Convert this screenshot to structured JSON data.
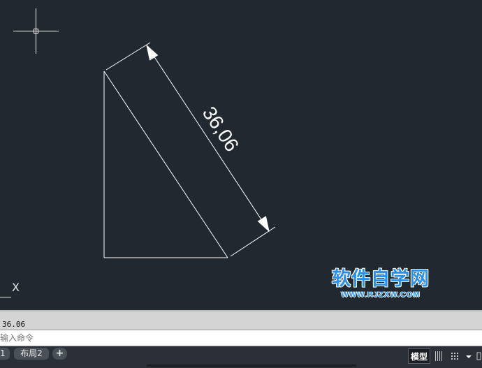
{
  "drawing": {
    "dimension_value": "36,06",
    "ucs_axis_label": "X"
  },
  "watermark": {
    "title": "软件自学网",
    "url": "WWW.RJZXW.COM"
  },
  "command_history": {
    "line": "36.06"
  },
  "command_line": {
    "placeholder": "输入命令"
  },
  "layout_tabs": [
    {
      "label": "1"
    },
    {
      "label": "布局2"
    },
    {
      "label": "+"
    }
  ],
  "status_bar": {
    "model_label": "模型",
    "icons": [
      "grid-icon",
      "snap-icon",
      "dropdown-arrow-icon",
      "more-icon"
    ]
  },
  "colors": {
    "canvas": "#212830",
    "geometry": "#ffffff",
    "watermark": "#2b8fe6"
  }
}
